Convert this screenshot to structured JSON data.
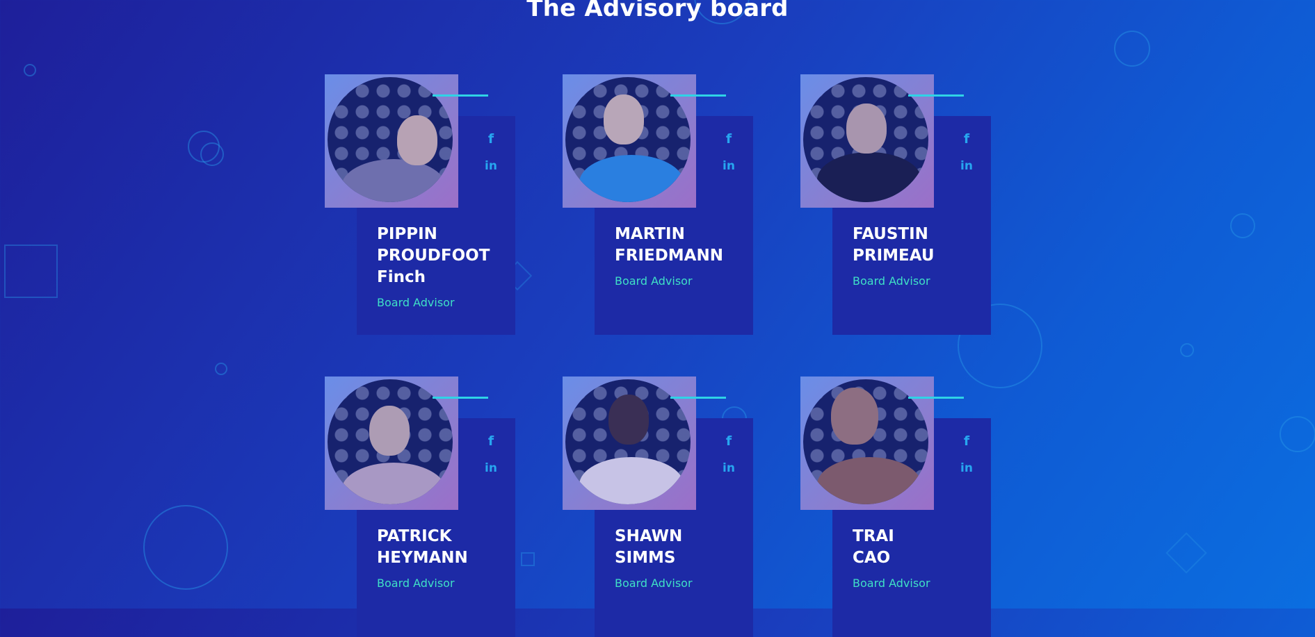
{
  "section": {
    "title": "The Advisory board"
  },
  "colors": {
    "accent_line": "#2fd3e6",
    "social_icon": "#27a6f0",
    "role_text": "#3fe0c6",
    "card_panel": "#1d2aa6"
  },
  "icons": {
    "facebook": "facebook-icon",
    "linkedin": "linkedin-icon"
  },
  "social_labels": {
    "facebook": "f",
    "linkedin": "in"
  },
  "advisors": [
    {
      "name_lines": [
        "PIPPIN",
        "PROUDFOOT",
        "Finch"
      ],
      "role": "Board Advisor"
    },
    {
      "name_lines": [
        "MARTIN",
        "FRIEDMANN"
      ],
      "role": "Board Advisor"
    },
    {
      "name_lines": [
        "FAUSTIN",
        "PRIMEAU"
      ],
      "role": "Board Advisor"
    },
    {
      "name_lines": [
        "PATRICK",
        "HEYMANN"
      ],
      "role": "Board Advisor"
    },
    {
      "name_lines": [
        "SHAWN",
        "SIMMS"
      ],
      "role": "Board Advisor"
    },
    {
      "name_lines": [
        "TRAI",
        "CAO"
      ],
      "role": "Board Advisor"
    }
  ]
}
